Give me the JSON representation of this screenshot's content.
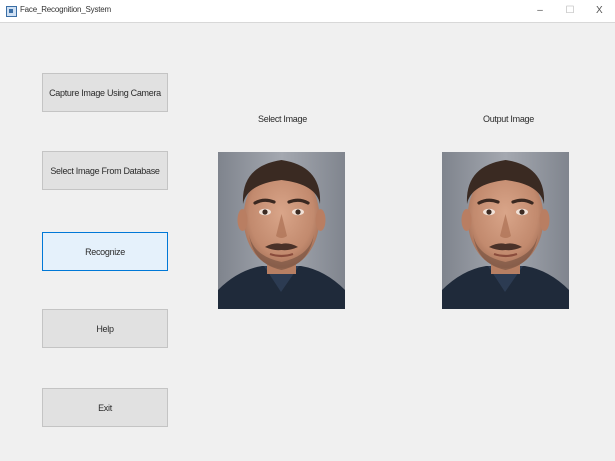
{
  "window": {
    "title": "Face_Recognition_System",
    "controls": {
      "minimize": "–",
      "maximize": "☐",
      "close": "X"
    }
  },
  "buttons": {
    "capture": "Capture Image Using Camera",
    "select": "Select Image From Database",
    "recognize": "Recognize",
    "help": "Help",
    "exit": "Exit"
  },
  "panels": {
    "select_label": "Select Image",
    "output_label": "Output Image"
  },
  "colors": {
    "window_bg": "#f0f0f0",
    "button_bg": "#e1e1e1",
    "focused_button_bg": "#e5f1fb",
    "focused_button_border": "#0078d7"
  },
  "icons": {
    "app": "app-icon"
  }
}
